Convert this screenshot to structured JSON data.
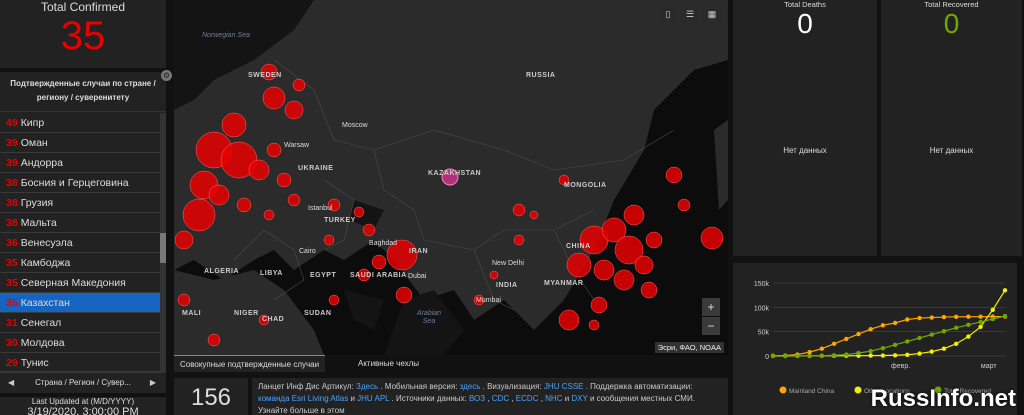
{
  "total": {
    "title": "Total Confirmed",
    "value": "35"
  },
  "country_panel": {
    "header": "Подтвержденные случаи по стране / региону / суверенитету",
    "items": [
      {
        "count": "49",
        "name": "Кипр"
      },
      {
        "count": "39",
        "name": "Оман"
      },
      {
        "count": "39",
        "name": "Андорра"
      },
      {
        "count": "38",
        "name": "Босния и Герцеговина"
      },
      {
        "count": "38",
        "name": "Грузия"
      },
      {
        "count": "38",
        "name": "Мальта"
      },
      {
        "count": "36",
        "name": "Венесуэла"
      },
      {
        "count": "35",
        "name": "Камбоджа"
      },
      {
        "count": "35",
        "name": "Северная Македония"
      },
      {
        "count": "35",
        "name": "Казахстан"
      },
      {
        "count": "31",
        "name": "Сенегал"
      },
      {
        "count": "30",
        "name": "Молдова"
      },
      {
        "count": "29",
        "name": "Тунис"
      }
    ],
    "selected_index": 9,
    "footer": "Страна / Регион / Сувер...",
    "arrow_left": "◀",
    "arrow_right": "▶"
  },
  "last_updated": {
    "label": "Last Updated at (M/D/YYYY)",
    "timestamp": "3/19/2020, 3:00:00 PM"
  },
  "map": {
    "countries": [
      "RUSSIA",
      "SWEDEN",
      "UKRAINE",
      "KAZAKHSTAN",
      "MONGOLIA",
      "CHINA",
      "TURKEY",
      "IRAN",
      "LIBYA",
      "EGYPT",
      "SAUDI ARABIA",
      "INDIA",
      "MYANMAR",
      "SUDAN",
      "CHAD",
      "NIGER",
      "MALI",
      "ALGERIA"
    ],
    "seas": [
      {
        "name": "Norwegian Sea"
      },
      {
        "name": "Arabian Sea"
      }
    ],
    "cities": [
      "Moscow",
      "Warsaw",
      "Istanbul",
      "Baghdad",
      "Dubai",
      "New Delhi",
      "Mumbai",
      "Cairo"
    ],
    "attribution": "Эсри, ФАО, NOAA",
    "tools": [
      "bookmark-icon",
      "list-icon",
      "qr-icon"
    ],
    "zoom_in": "+",
    "zoom_out": "−"
  },
  "map_tabs": [
    {
      "label": "Совокупные подтвержденные случаи",
      "active": true
    },
    {
      "label": "Активные чехлы",
      "active": false
    }
  ],
  "bottom": {
    "count": "156",
    "text_parts": [
      {
        "text": "Ланцет Инф Дис Артикул: ",
        "link": false
      },
      {
        "text": "Здесь",
        "link": true
      },
      {
        "text": " . Мобильная версия: ",
        "link": false
      },
      {
        "text": "здесь",
        "link": true
      },
      {
        "text": " . Визуализация: ",
        "link": false
      },
      {
        "text": "JHU CSSE",
        "link": true
      },
      {
        "text": " . Поддержка автоматизации: ",
        "link": false
      },
      {
        "text": "команда Esri Living Atlas",
        "link": true
      },
      {
        "text": " и ",
        "link": false
      },
      {
        "text": "JHU APL",
        "link": true
      },
      {
        "text": " . Источники данных: ",
        "link": false
      },
      {
        "text": "ВОЗ",
        "link": true
      },
      {
        "text": " , ",
        "link": false
      },
      {
        "text": "CDC",
        "link": true
      },
      {
        "text": " , ",
        "link": false
      },
      {
        "text": "ECDC",
        "link": true
      },
      {
        "text": " , ",
        "link": false
      },
      {
        "text": "NHC",
        "link": true
      },
      {
        "text": " и ",
        "link": false
      },
      {
        "text": "DXY",
        "link": true
      },
      {
        "text": " и сообщения местных СМИ. Узнайте больше в этом",
        "link": false
      }
    ]
  },
  "deaths": {
    "title": "Total Deaths",
    "value": "0",
    "empty": "Нет данных",
    "color": "#ffffff"
  },
  "recovered": {
    "title": "Total Recovered",
    "value": "0",
    "empty": "Нет данных",
    "color": "#70a800"
  },
  "chart_data": {
    "type": "line",
    "y_ticks": [
      "150k",
      "100k",
      "50k",
      "0"
    ],
    "ylim": [
      0,
      150000
    ],
    "x_ticks": [
      "февр.",
      "март"
    ],
    "series": [
      {
        "name": "Mainland China",
        "color": "#ffa500",
        "values": [
          500,
          1000,
          3000,
          8000,
          15000,
          25000,
          35000,
          45000,
          55000,
          63000,
          68000,
          75000,
          78000,
          79000,
          80000,
          80500,
          80700,
          80800,
          80900,
          81000
        ]
      },
      {
        "name": "Other Locations",
        "color": "#f0f000",
        "values": [
          0,
          0,
          100,
          200,
          300,
          400,
          500,
          600,
          800,
          1000,
          1500,
          2500,
          5000,
          9000,
          15000,
          25000,
          40000,
          60000,
          95000,
          135000
        ]
      },
      {
        "name": "Total Recovered",
        "color": "#70a800",
        "values": [
          0,
          0,
          0,
          100,
          500,
          1500,
          3000,
          6000,
          10000,
          16000,
          23000,
          30000,
          37000,
          44000,
          51000,
          58000,
          64000,
          70000,
          76000,
          82000
        ]
      }
    ],
    "legend_position": "bottom"
  },
  "watermark": "RussInfo.net"
}
